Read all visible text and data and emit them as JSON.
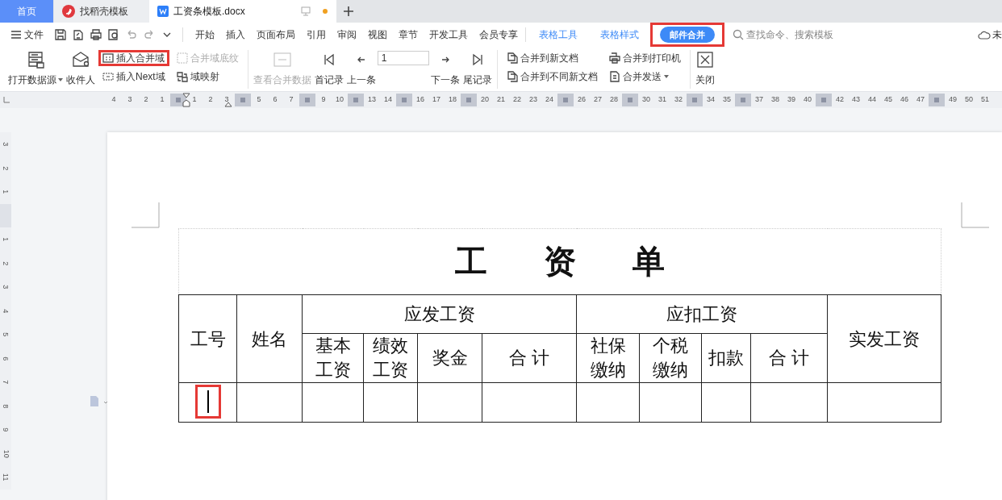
{
  "tabs": [
    {
      "label": "首页",
      "kind": "home",
      "selected": false
    },
    {
      "label": "找稻壳模板",
      "kind": "docer",
      "selected": false
    },
    {
      "label": "工资条模板.docx",
      "kind": "doc",
      "selected": true
    }
  ],
  "menu": {
    "file": "文件",
    "tabs": [
      {
        "label": "开始",
        "kind": "main",
        "selected": false
      },
      {
        "label": "插入",
        "kind": "main",
        "selected": false
      },
      {
        "label": "页面布局",
        "kind": "main",
        "selected": false
      },
      {
        "label": "引用",
        "kind": "main",
        "selected": false
      },
      {
        "label": "审阅",
        "kind": "main",
        "selected": false
      },
      {
        "label": "视图",
        "kind": "main",
        "selected": false
      },
      {
        "label": "章节",
        "kind": "main",
        "selected": false
      },
      {
        "label": "开发工具",
        "kind": "main",
        "selected": false
      },
      {
        "label": "会员专享",
        "kind": "main",
        "selected": false
      },
      {
        "label": "表格工具",
        "kind": "context",
        "selected": false
      },
      {
        "label": "表格样式",
        "kind": "context",
        "selected": false
      },
      {
        "label": "邮件合并",
        "kind": "context",
        "selected": true,
        "highlighted": true
      }
    ],
    "search_placeholder": "查找命令、搜索模板",
    "sync": "未"
  },
  "ribbon": [
    {
      "kind": "large",
      "label": "打开数据源",
      "caret": true,
      "disabled": false
    },
    {
      "kind": "large",
      "label": "收件人",
      "disabled": false
    },
    {
      "kind": "stack",
      "items": [
        {
          "label": "插入合并域",
          "disabled": false,
          "highlighted": true
        },
        {
          "label": "插入Next域",
          "disabled": false,
          "highlighted": false
        }
      ]
    },
    {
      "kind": "stack",
      "items": [
        {
          "label": "合并域底纹",
          "disabled": true,
          "highlighted": false
        },
        {
          "label": "域映射",
          "disabled": false,
          "highlighted": false
        }
      ]
    },
    {
      "kind": "large",
      "label": "查看合并数据",
      "disabled": true,
      "separator": true
    },
    {
      "kind": "large",
      "label": "首记录",
      "disabled": false
    },
    {
      "kind": "large",
      "label": "上一条",
      "disabled": false
    },
    {
      "kind": "record",
      "value": "1"
    },
    {
      "kind": "large",
      "label": "下一条",
      "disabled": false
    },
    {
      "kind": "large",
      "label": "尾记录",
      "disabled": false
    },
    {
      "kind": "stack",
      "separator": true,
      "items": [
        {
          "label": "合并到新文档",
          "disabled": false,
          "highlighted": false
        },
        {
          "label": "合并到不同新文档",
          "disabled": false,
          "highlighted": false
        }
      ]
    },
    {
      "kind": "stack",
      "items": [
        {
          "label": "合并到打印机",
          "disabled": false,
          "highlighted": false
        },
        {
          "label": "合并发送",
          "caret": true,
          "disabled": false,
          "highlighted": false
        }
      ]
    },
    {
      "kind": "large",
      "label": "关闭",
      "separator": true,
      "disabled": false
    }
  ],
  "ruler": [
    {
      "kind": "num",
      "text": "4"
    },
    {
      "kind": "num",
      "text": "3"
    },
    {
      "kind": "num",
      "text": "2"
    },
    {
      "kind": "num",
      "text": "1"
    },
    {
      "kind": "mark"
    },
    {
      "kind": "num",
      "text": "1"
    },
    {
      "kind": "num",
      "text": "2"
    },
    {
      "kind": "num",
      "text": "3"
    },
    {
      "kind": "mark"
    },
    {
      "kind": "num",
      "text": "5"
    },
    {
      "kind": "num",
      "text": "6"
    },
    {
      "kind": "num",
      "text": "7"
    },
    {
      "kind": "mark"
    },
    {
      "kind": "num",
      "text": "9"
    },
    {
      "kind": "num",
      "text": "10"
    },
    {
      "kind": "mark"
    },
    {
      "kind": "num",
      "text": "13"
    },
    {
      "kind": "num",
      "text": "14"
    },
    {
      "kind": "mark"
    },
    {
      "kind": "num",
      "text": "16"
    },
    {
      "kind": "num",
      "text": "17"
    },
    {
      "kind": "num",
      "text": "18"
    },
    {
      "kind": "mark"
    },
    {
      "kind": "num",
      "text": "20"
    },
    {
      "kind": "num",
      "text": "21"
    },
    {
      "kind": "num",
      "text": "22"
    },
    {
      "kind": "num",
      "text": "23"
    },
    {
      "kind": "num",
      "text": "24"
    },
    {
      "kind": "mark"
    },
    {
      "kind": "num",
      "text": "26"
    },
    {
      "kind": "num",
      "text": "27"
    },
    {
      "kind": "num",
      "text": "28"
    },
    {
      "kind": "mark"
    },
    {
      "kind": "num",
      "text": "30"
    },
    {
      "kind": "num",
      "text": "31"
    },
    {
      "kind": "num",
      "text": "32"
    },
    {
      "kind": "mark"
    },
    {
      "kind": "num",
      "text": "34"
    },
    {
      "kind": "num",
      "text": "35"
    },
    {
      "kind": "mark"
    },
    {
      "kind": "num",
      "text": "37"
    },
    {
      "kind": "num",
      "text": "38"
    },
    {
      "kind": "num",
      "text": "39"
    },
    {
      "kind": "num",
      "text": "40"
    },
    {
      "kind": "mark"
    },
    {
      "kind": "num",
      "text": "42"
    },
    {
      "kind": "num",
      "text": "43"
    },
    {
      "kind": "num",
      "text": "44"
    },
    {
      "kind": "num",
      "text": "45"
    },
    {
      "kind": "num",
      "text": "46"
    },
    {
      "kind": "num",
      "text": "47"
    },
    {
      "kind": "mark"
    },
    {
      "kind": "num",
      "text": "49"
    },
    {
      "kind": "num",
      "text": "50"
    },
    {
      "kind": "num",
      "text": "51"
    }
  ],
  "vertical_ruler": [
    {
      "kind": "num",
      "text": "3"
    },
    {
      "kind": "num",
      "text": "2"
    },
    {
      "kind": "num",
      "text": "1"
    },
    {
      "kind": "mark"
    },
    {
      "kind": "num",
      "text": "1"
    },
    {
      "kind": "num",
      "text": "2"
    },
    {
      "kind": "num",
      "text": "3"
    },
    {
      "kind": "num",
      "text": "4"
    },
    {
      "kind": "num",
      "text": "5"
    },
    {
      "kind": "num",
      "text": "6"
    },
    {
      "kind": "num",
      "text": "7"
    },
    {
      "kind": "num",
      "text": "8"
    },
    {
      "kind": "num",
      "text": "9"
    },
    {
      "kind": "num",
      "text": "10"
    },
    {
      "kind": "num",
      "text": "11"
    }
  ],
  "table": {
    "title": "工资单",
    "left_headers": [
      "工号",
      "姓名"
    ],
    "groups": [
      {
        "label": "应发工资",
        "columns": [
          "基本工资",
          "绩效工资",
          "奖金",
          "合 计"
        ]
      },
      {
        "label": "应扣工资",
        "columns": [
          "社保缴纳",
          "个税缴纳",
          "扣款",
          "合 计"
        ]
      }
    ],
    "right_header": "实发工资",
    "rows": [
      {
        "cells": [
          {
            "cursor": true,
            "highlighted": true
          },
          {
            "cursor": false,
            "highlighted": false
          },
          {
            "cursor": false,
            "highlighted": false
          },
          {
            "cursor": false,
            "highlighted": false
          },
          {
            "cursor": false,
            "highlighted": false
          },
          {
            "cursor": false,
            "highlighted": false
          },
          {
            "cursor": false,
            "highlighted": false
          },
          {
            "cursor": false,
            "highlighted": false
          },
          {
            "cursor": false,
            "highlighted": false
          },
          {
            "cursor": false,
            "highlighted": false
          },
          {
            "cursor": false,
            "highlighted": false
          }
        ]
      }
    ]
  }
}
